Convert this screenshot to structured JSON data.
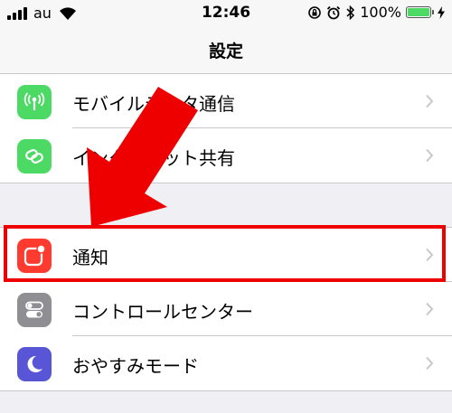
{
  "status_bar": {
    "carrier": "au",
    "time": "12:46",
    "battery_percent": "100%",
    "battery_level": 1.0,
    "battery_color": "#4cd964",
    "icons": [
      "signal-icon",
      "wifi-icon",
      "rotation-lock-icon",
      "alarm-icon",
      "bluetooth-icon",
      "battery-icon",
      "charging-bolt-icon"
    ]
  },
  "navbar": {
    "title": "設定"
  },
  "groups": [
    {
      "items": [
        {
          "label": "モバイルデータ通信",
          "icon": "cellular-antenna-icon",
          "icon_color": "#4cd964"
        },
        {
          "label": "インターネット共有",
          "icon": "link-icon",
          "icon_color": "#4cd964"
        }
      ]
    },
    {
      "items": [
        {
          "label": "通知",
          "icon": "notifications-icon",
          "icon_color": "#ff3b30",
          "highlighted": true
        },
        {
          "label": "コントロールセンター",
          "icon": "toggle-switches-icon",
          "icon_color": "#8e8e93"
        },
        {
          "label": "おやすみモード",
          "icon": "moon-icon",
          "icon_color": "#5856d6"
        }
      ]
    }
  ],
  "annotation": {
    "color": "#ee0000",
    "icon": "pointer-arrow-icon"
  }
}
